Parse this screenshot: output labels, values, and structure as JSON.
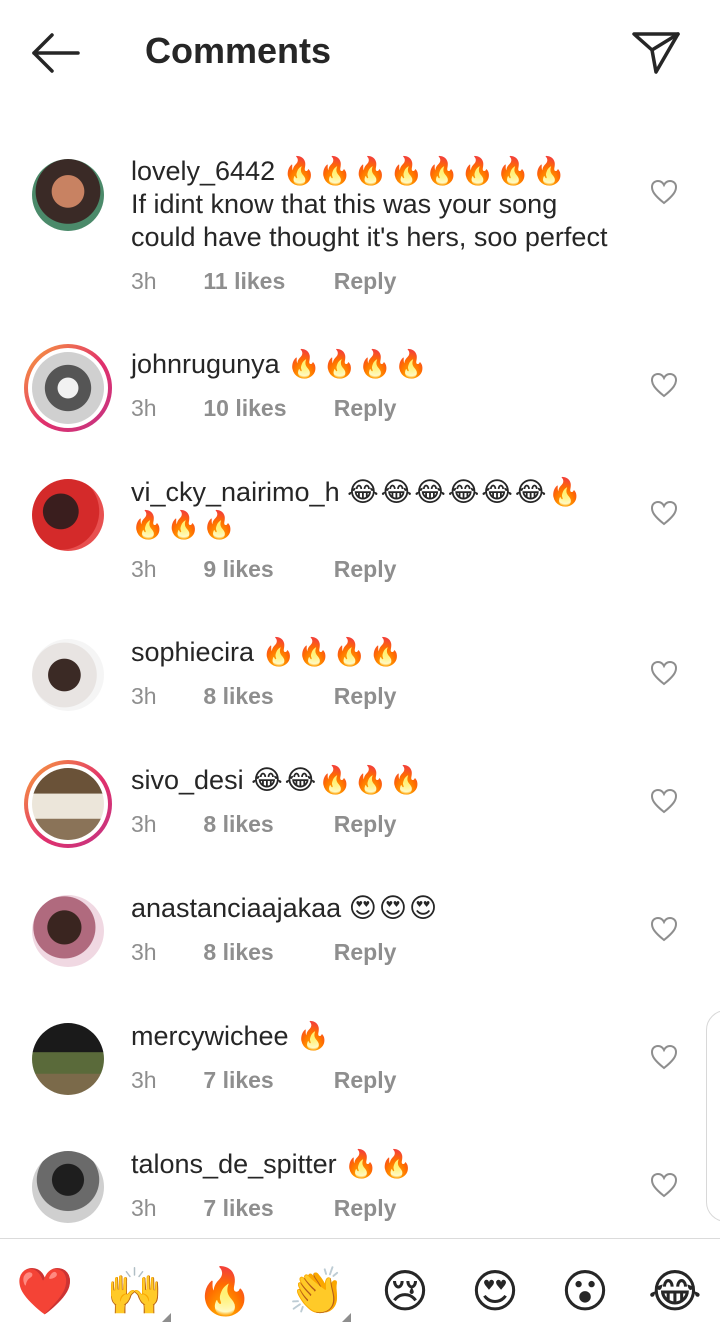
{
  "header": {
    "title": "Comments"
  },
  "comments": [
    {
      "username": "lovely_6442",
      "emojis": "🔥🔥🔥🔥🔥🔥🔥🔥",
      "text_lines": [
        "If idint know that this was your song",
        "could have thought it's hers, soo perfect"
      ],
      "time": "3h",
      "likes": "11 likes",
      "reply": "Reply"
    },
    {
      "username": "johnrugunya",
      "emojis": "🔥🔥🔥🔥",
      "text_lines": [],
      "time": "3h",
      "likes": "10 likes",
      "reply": "Reply"
    },
    {
      "username": "vi_cky_nairimo_h",
      "emojis": "😂😂😂😂😂😂🔥",
      "text_lines": [
        "🔥🔥🔥"
      ],
      "time": "3h",
      "likes": "9 likes",
      "reply": "Reply"
    },
    {
      "username": "sophiecira",
      "emojis": "🔥🔥🔥🔥",
      "text_lines": [],
      "time": "3h",
      "likes": "8 likes",
      "reply": "Reply"
    },
    {
      "username": "sivo_desi",
      "emojis": "😂😂🔥🔥🔥",
      "text_lines": [],
      "time": "3h",
      "likes": "8 likes",
      "reply": "Reply"
    },
    {
      "username": "anastanciaajakaa",
      "emojis": "😍😍😍",
      "text_lines": [],
      "time": "3h",
      "likes": "8 likes",
      "reply": "Reply"
    },
    {
      "username": "mercywichee",
      "emojis": "🔥",
      "text_lines": [],
      "time": "3h",
      "likes": "7 likes",
      "reply": "Reply"
    },
    {
      "username": "talons_de_spitter",
      "emojis": "🔥🔥",
      "text_lines": [],
      "time": "3h",
      "likes": "7 likes",
      "reply": "Reply"
    }
  ],
  "reactions": [
    "❤️",
    "🙌",
    "🔥",
    "👏",
    "😢",
    "😍",
    "😮",
    "😂"
  ],
  "icons": {
    "back": "arrow-left-icon",
    "send": "paper-plane-icon",
    "like": "heart-outline-icon"
  },
  "colors": {
    "text": "#262626",
    "secondary": "#8e8e8e",
    "story_ring_start": "#f9a33a",
    "story_ring_end": "#c13584"
  }
}
